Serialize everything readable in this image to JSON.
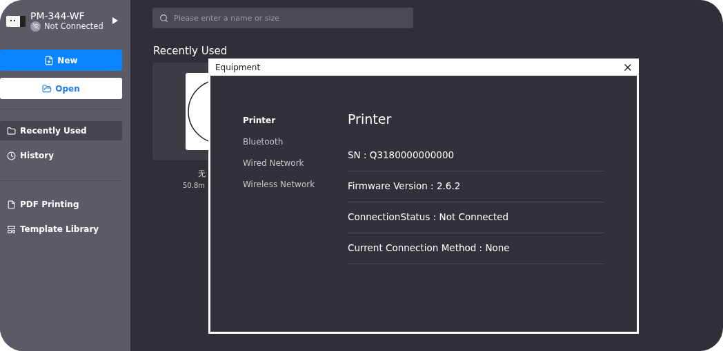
{
  "device": {
    "name": "PM-344-WF",
    "status": "Not Connected",
    "connected": false
  },
  "actions": [
    {
      "kind": "primary",
      "label": "New"
    },
    {
      "kind": "secondary",
      "label": "Open"
    }
  ],
  "nav_groups": [
    [
      {
        "label": "Recently Used",
        "kind": "folder",
        "selected": true
      },
      {
        "label": "History",
        "kind": "clock",
        "selected": false
      }
    ],
    [
      {
        "label": "PDF Printing",
        "kind": "file",
        "selected": false
      },
      {
        "label": "Template Library",
        "kind": "layout",
        "selected": false
      }
    ]
  ],
  "search": {
    "placeholder": "Please enter a name or size"
  },
  "section_title": "Recently Used",
  "templates": [
    {
      "name": "无",
      "size": "50.8m"
    }
  ],
  "dialog": {
    "title": "Equipment",
    "tabs": [
      {
        "label": "Printer",
        "selected": true
      },
      {
        "label": "Bluetooth",
        "selected": false
      },
      {
        "label": "Wired Network",
        "selected": false
      },
      {
        "label": "Wireless Network",
        "selected": false
      }
    ],
    "heading": "Printer",
    "rows": [
      "SN :  Q3180000000000",
      "Firmware Version  :  2.6.2",
      "ConnectionStatus  :  Not Connected",
      "Current Connection Method  :  None"
    ]
  }
}
